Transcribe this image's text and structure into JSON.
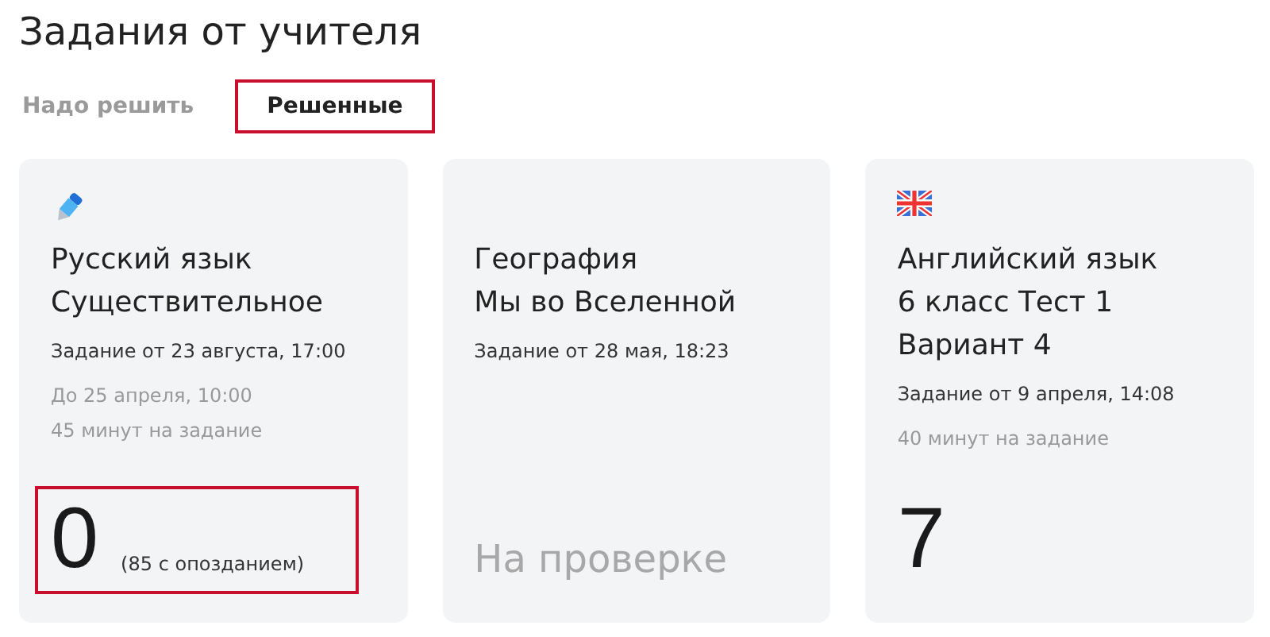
{
  "page": {
    "title": "Задания от учителя"
  },
  "tabs": [
    {
      "label": "Надо решить",
      "selected": false
    },
    {
      "label": "Решенные",
      "selected": true
    }
  ],
  "cards": [
    {
      "kind": "pen",
      "title_lines": [
        "Русский язык",
        "Существительное"
      ],
      "assigned": "Задание от 23 августа, 17:00",
      "details": [
        "До 25 апреля, 10:00",
        "45 минут на задание"
      ],
      "result": {
        "kind": "grade",
        "value": "0",
        "note": "(85 с опозданием)",
        "highlighted": true
      }
    },
    {
      "kind": "plain",
      "title_lines": [
        "География",
        "Мы во Вселенной"
      ],
      "assigned": "Задание от 28 мая, 18:23",
      "result": {
        "kind": "status",
        "value": "На проверке",
        "highlighted": false
      }
    },
    {
      "kind": "flag",
      "title_lines": [
        "Английский язык",
        "6 класс Тест 1",
        "Вариант 4"
      ],
      "assigned": "Задание от 9 апреля, 14:08",
      "details": [
        "40 минут на задание"
      ],
      "result": {
        "kind": "grade",
        "value": "7",
        "highlighted": false
      }
    }
  ]
}
